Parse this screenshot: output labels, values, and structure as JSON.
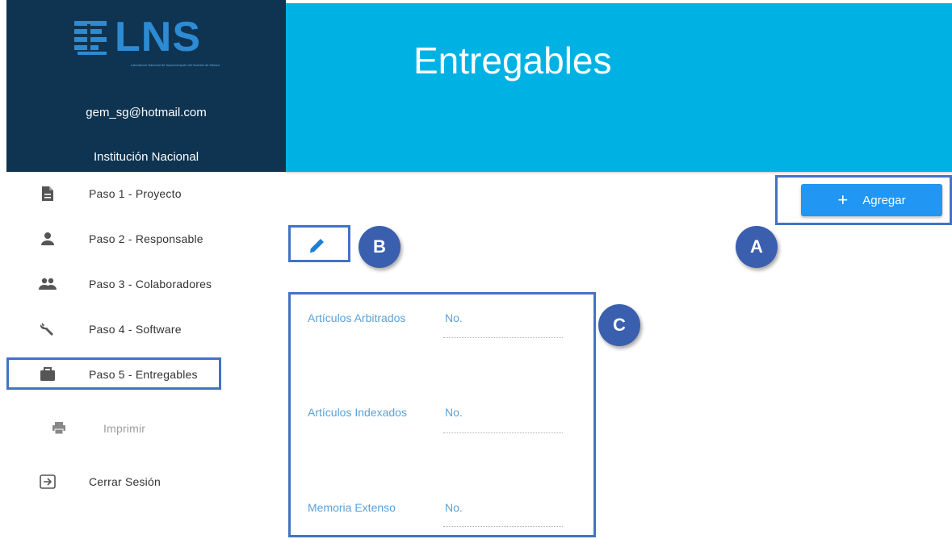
{
  "sidebar": {
    "logo_text": "LNS",
    "logo_subtitle": "Laboratorio Nacional de Supercómputo del Sureste de México",
    "user_email": "gem_sg@hotmail.com",
    "institution": "Institución Nacional",
    "items": [
      {
        "label": "Paso 1 - Proyecto",
        "icon": "document-icon"
      },
      {
        "label": "Paso 2 - Responsable",
        "icon": "person-icon"
      },
      {
        "label": "Paso 3 - Colaboradores",
        "icon": "people-icon"
      },
      {
        "label": "Paso 4 - Software",
        "icon": "wrench-icon"
      },
      {
        "label": "Paso 5 - Entregables",
        "icon": "briefcase-icon"
      },
      {
        "label": "Imprimir",
        "icon": "printer-icon"
      },
      {
        "label": "Cerrar Sesión",
        "icon": "logout-icon"
      }
    ]
  },
  "header": {
    "title": "Entregables"
  },
  "toolbar": {
    "add_label": "Agregar"
  },
  "fields": [
    {
      "label": "Artículos Arbitrados",
      "value": "No."
    },
    {
      "label": "Artículos Indexados",
      "value": "No."
    },
    {
      "label": "Memoria Extenso",
      "value": "No."
    }
  ],
  "annotations": {
    "a": "A",
    "b": "B",
    "c": "C"
  },
  "colors": {
    "sidebar_bg": "#0f3451",
    "header_bg": "#00b2e3",
    "accent": "#2196f3",
    "annotation": "#4472c4",
    "field_text": "#5aa2d8"
  }
}
